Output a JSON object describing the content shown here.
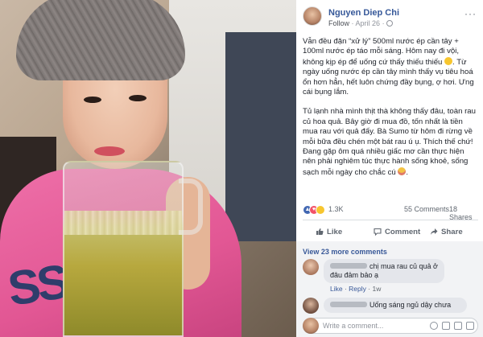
{
  "post": {
    "author": "Nguyen Diep Chi",
    "follow_label": "Follow",
    "date": "April 26",
    "more_label": "···",
    "paragraph1": "Vẫn đều đặn “xử lý” 500ml nước ép cần tây + 100ml nước ép táo mỗi sáng. Hôm nay đi vội, không kịp ép để uống cứ thấy thiếu thiếu",
    "paragraph1_tail": ". Từ ngày uống nước ép cần tây mình thấy vụ tiêu hoá ổn hơn hẳn, hết luôn chứng đầy bụng, ợ hơi. Ưng cái bụng lắm.",
    "paragraph2": "Tủ lạnh nhà mình thịt thà không thấy đâu, toàn rau củ hoa quả. Bây giờ đi mua đồ, tốn nhất là tiền mua rau với quả đấy. Bà Sumo từ hôm đi rừng về mỗi bữa đều chén một bát rau ú ụ. Thích thế chứ! Đang gặp ôm quá nhiều giấc mơ cần thực hiện nên phải nghiêm túc thực hành sống khoẻ, sống sạch mỗi ngày cho chắc cú"
  },
  "stats": {
    "reaction_count": "1.3K",
    "comments": "55 Comments",
    "shares": "18 Shares"
  },
  "actions": {
    "like": "Like",
    "comment": "Comment",
    "share": "Share"
  },
  "comments": {
    "view_more": "View 23 more comments",
    "items": [
      {
        "text": "chị mua rau củ quả ở đâu đảm bảo ạ",
        "like": "Like",
        "reply": "Reply",
        "time": "1w"
      },
      {
        "text": "Uống sáng ngủ dậy chưa",
        "like": "",
        "reply": "",
        "time": ""
      }
    ]
  },
  "write_comment": {
    "placeholder": "Write a comment..."
  },
  "icons": {
    "globe": "globe-icon",
    "like": "thumbs-up-icon",
    "comment": "speech-bubble-icon",
    "share": "share-arrow-icon"
  },
  "colors": {
    "link": "#365899",
    "reaction_like": "#4267b2",
    "reaction_love": "#f25268",
    "reaction_haha": "#f7c62f"
  }
}
